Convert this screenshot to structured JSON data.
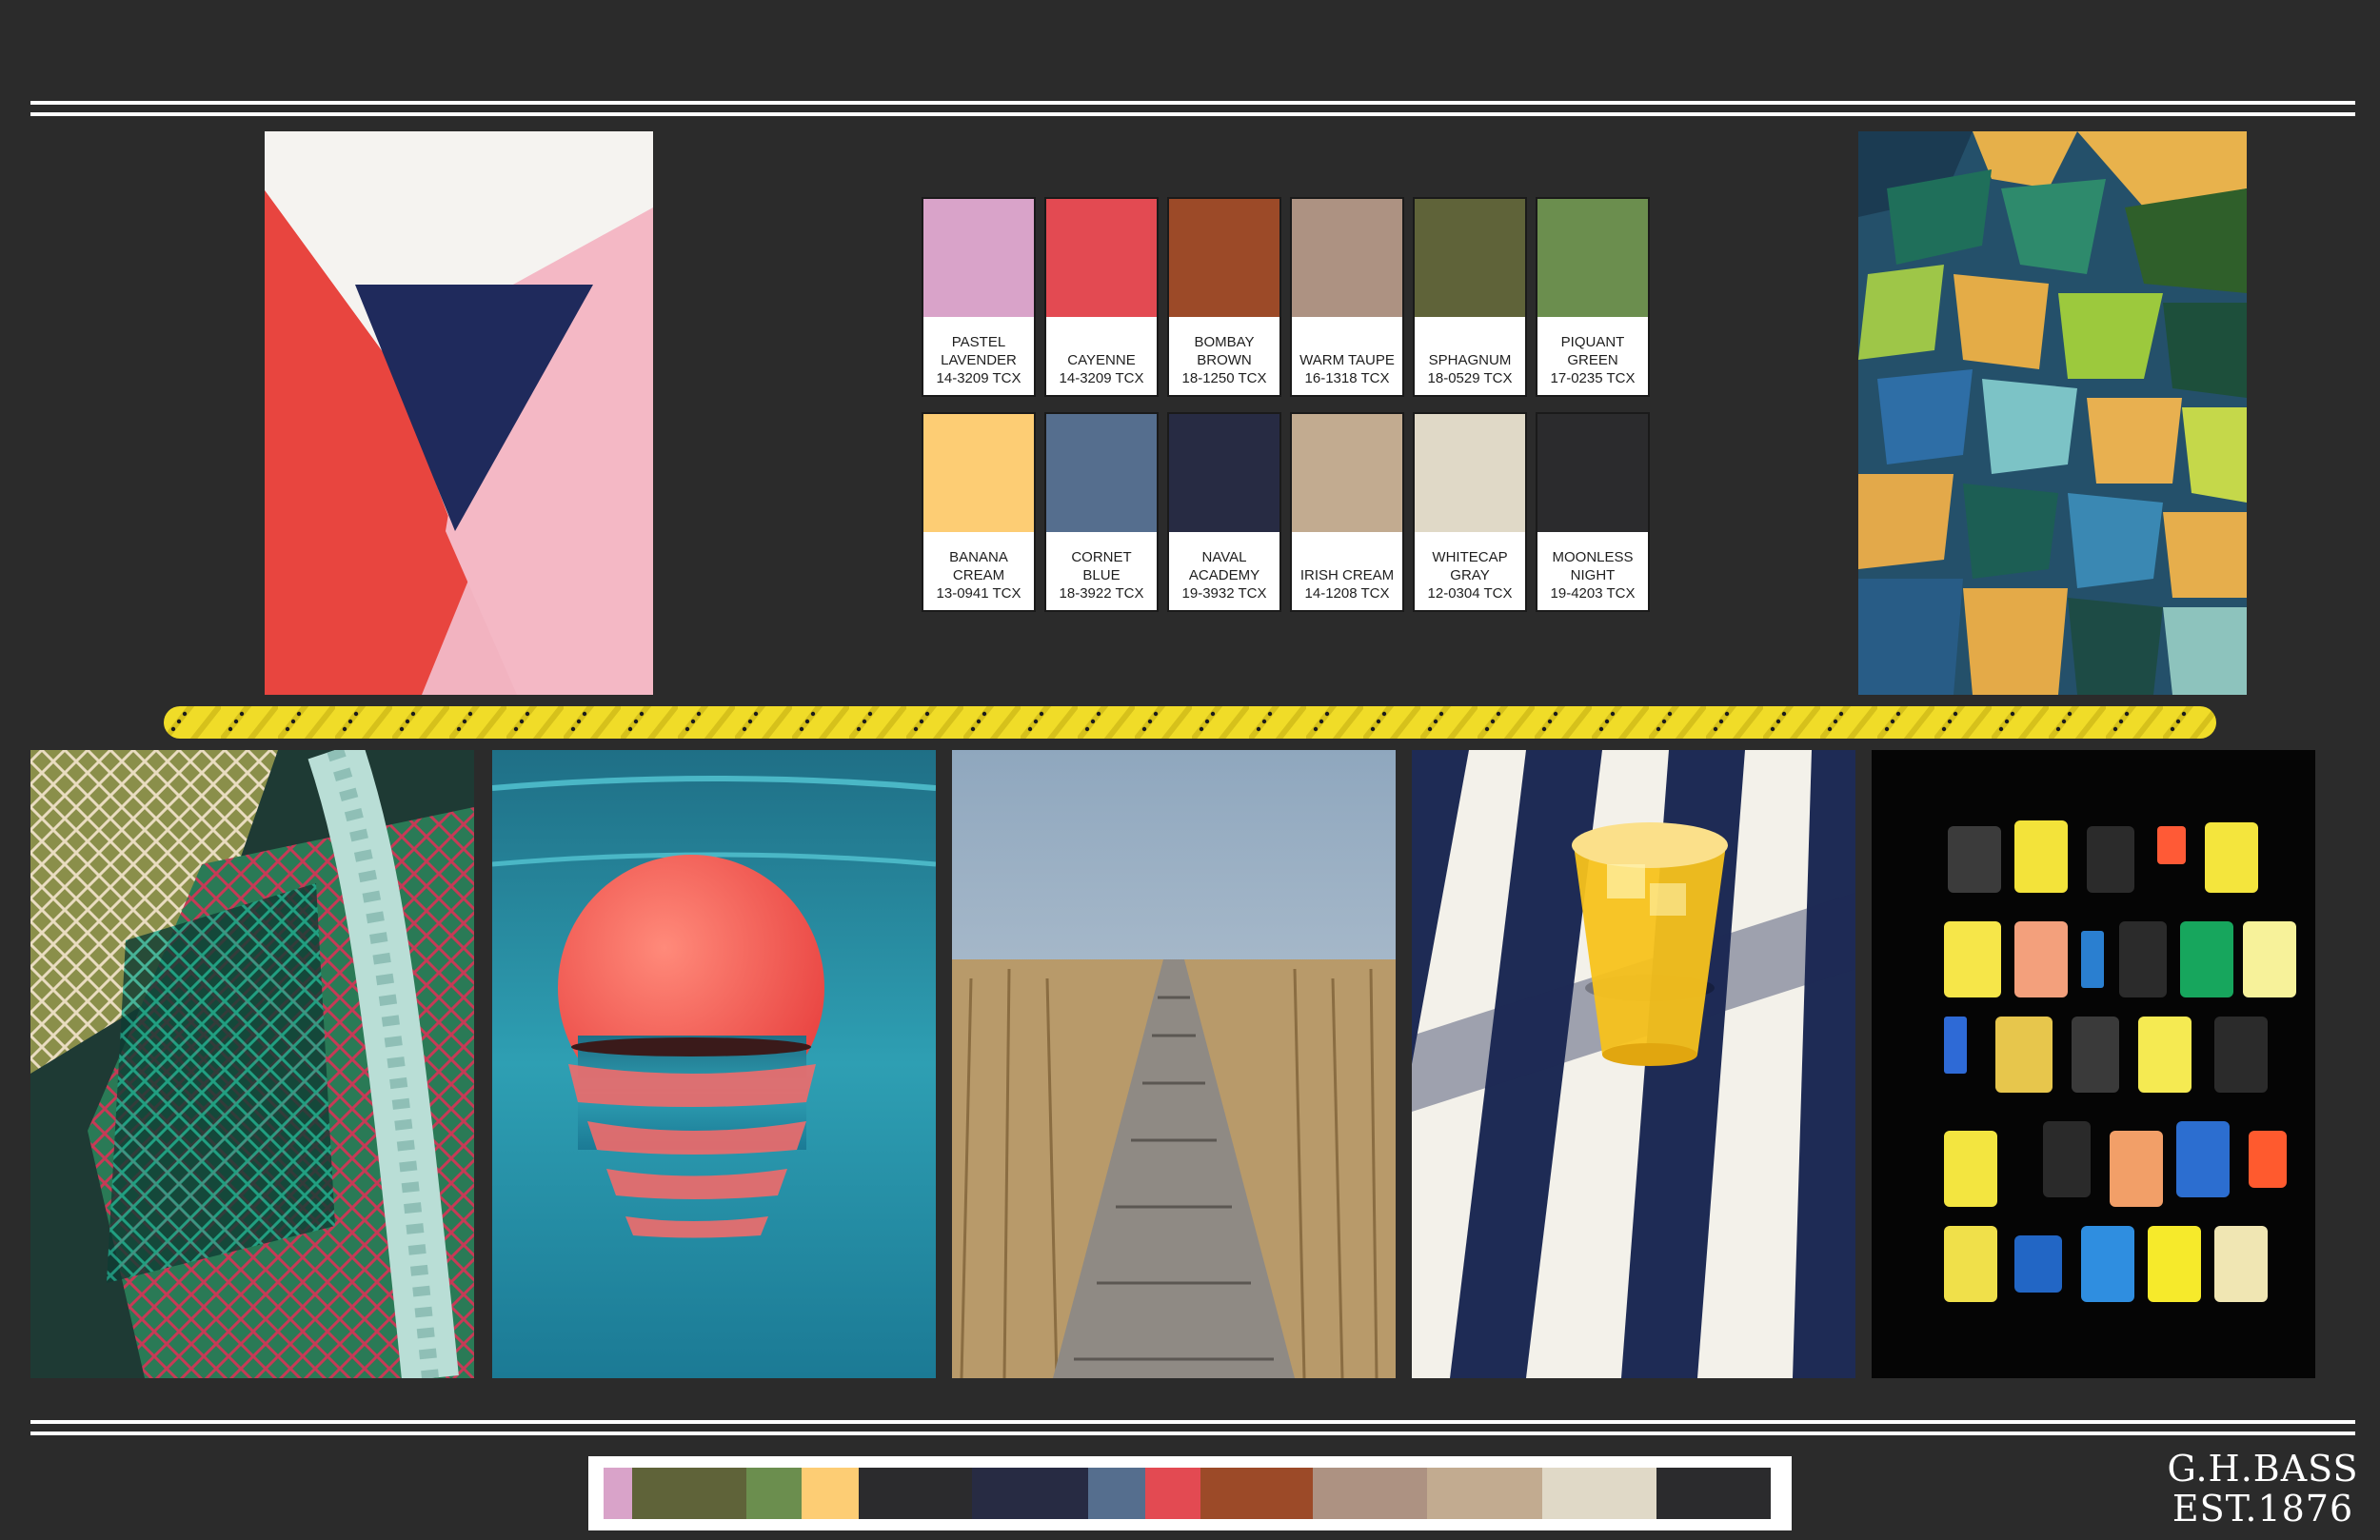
{
  "pantone_chips": [
    {
      "name": "PASTEL LAVENDER",
      "code": "14-3209 TCX",
      "color": "#d9a3c9"
    },
    {
      "name": "CAYENNE",
      "code": "14-3209 TCX",
      "color": "#e34a52"
    },
    {
      "name": "BOMBAY BROWN",
      "code": "18-1250 TCX",
      "color": "#9c4a28"
    },
    {
      "name": "WARM TAUPE",
      "code": "16-1318 TCX",
      "color": "#ad9282"
    },
    {
      "name": "SPHAGNUM",
      "code": "18-0529 TCX",
      "color": "#5f6339"
    },
    {
      "name": "PIQUANT GREEN",
      "code": "17-0235 TCX",
      "color": "#6b8e4e"
    },
    {
      "name": "BANANA CREAM",
      "code": "13-0941 TCX",
      "color": "#fdcd74"
    },
    {
      "name": "CORNET BLUE",
      "code": "18-3922 TCX",
      "color": "#556e8e"
    },
    {
      "name": "NAVAL ACADEMY",
      "code": "19-3932 TCX",
      "color": "#272b43"
    },
    {
      "name": "IRISH CREAM",
      "code": "14-1208 TCX",
      "color": "#c2ab90"
    },
    {
      "name": "WHITECAP GRAY",
      "code": "12-0304 TCX",
      "color": "#e0d9c7"
    },
    {
      "name": "MOONLESS NIGHT",
      "code": "19-4203 TCX",
      "color": "#2b2b2d"
    }
  ],
  "palette_bar": [
    {
      "color": "#d9a3c9",
      "share": 30
    },
    {
      "color": "#5f6339",
      "share": 120
    },
    {
      "color": "#6b8e4e",
      "share": 58
    },
    {
      "color": "#fdcd74",
      "share": 60
    },
    {
      "color": "#2b2b2d",
      "share": 118
    },
    {
      "color": "#272b43",
      "share": 122
    },
    {
      "color": "#556e8e",
      "share": 60
    },
    {
      "color": "#e34a52",
      "share": 58
    },
    {
      "color": "#9c4a28",
      "share": 118
    },
    {
      "color": "#ad9282",
      "share": 120
    },
    {
      "color": "#c2ab90",
      "share": 120
    },
    {
      "color": "#e0d9c7",
      "share": 120
    },
    {
      "color": "#2b2b2d",
      "share": 120
    }
  ],
  "brand": {
    "line1": "G.H.BASS",
    "line2": "EST.1876"
  },
  "colors": {
    "background": "#2b2b2b",
    "rope": "#f0dc28",
    "rule": "#ffffff"
  }
}
